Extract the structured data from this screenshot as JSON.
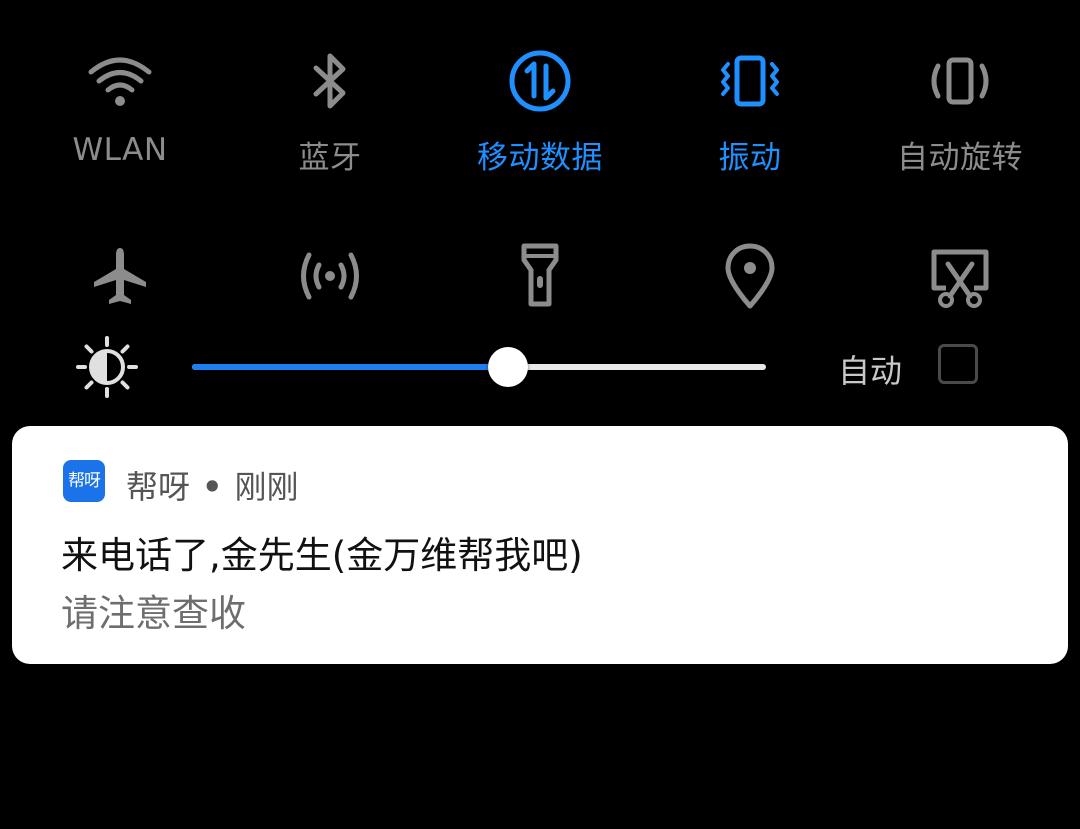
{
  "colors": {
    "background": "#000000",
    "inactive_icon": "#8c8c8c",
    "active_blue": "#1e90ff",
    "slider_fill": "#1f7ef0",
    "card_bg": "#ffffff"
  },
  "quick_settings": {
    "row1": [
      {
        "id": "wlan",
        "label": "WLAN",
        "icon": "wifi-icon",
        "active": false
      },
      {
        "id": "bluetooth",
        "label": "蓝牙",
        "icon": "bluetooth-icon",
        "active": false
      },
      {
        "id": "mobile-data",
        "label": "移动数据",
        "icon": "mobile-data-icon",
        "active": true
      },
      {
        "id": "vibrate",
        "label": "振动",
        "icon": "vibrate-icon",
        "active": true
      },
      {
        "id": "auto-rotate",
        "label": "自动旋转",
        "icon": "auto-rotate-icon",
        "active": false
      }
    ],
    "row2": [
      {
        "id": "airplane",
        "icon": "airplane-icon"
      },
      {
        "id": "hotspot",
        "icon": "hotspot-icon"
      },
      {
        "id": "flashlight",
        "icon": "flashlight-icon"
      },
      {
        "id": "location",
        "icon": "location-icon"
      },
      {
        "id": "screenshot",
        "icon": "screenshot-icon"
      }
    ]
  },
  "brightness": {
    "level": 0.55,
    "auto_label": "自动",
    "auto_checked": false
  },
  "notification": {
    "app_icon_text": "帮呀",
    "app_name": "帮呀",
    "separator": "•",
    "time": "刚刚",
    "title": "来电话了,金先生(金万维帮我吧)",
    "body": "请注意查收"
  }
}
